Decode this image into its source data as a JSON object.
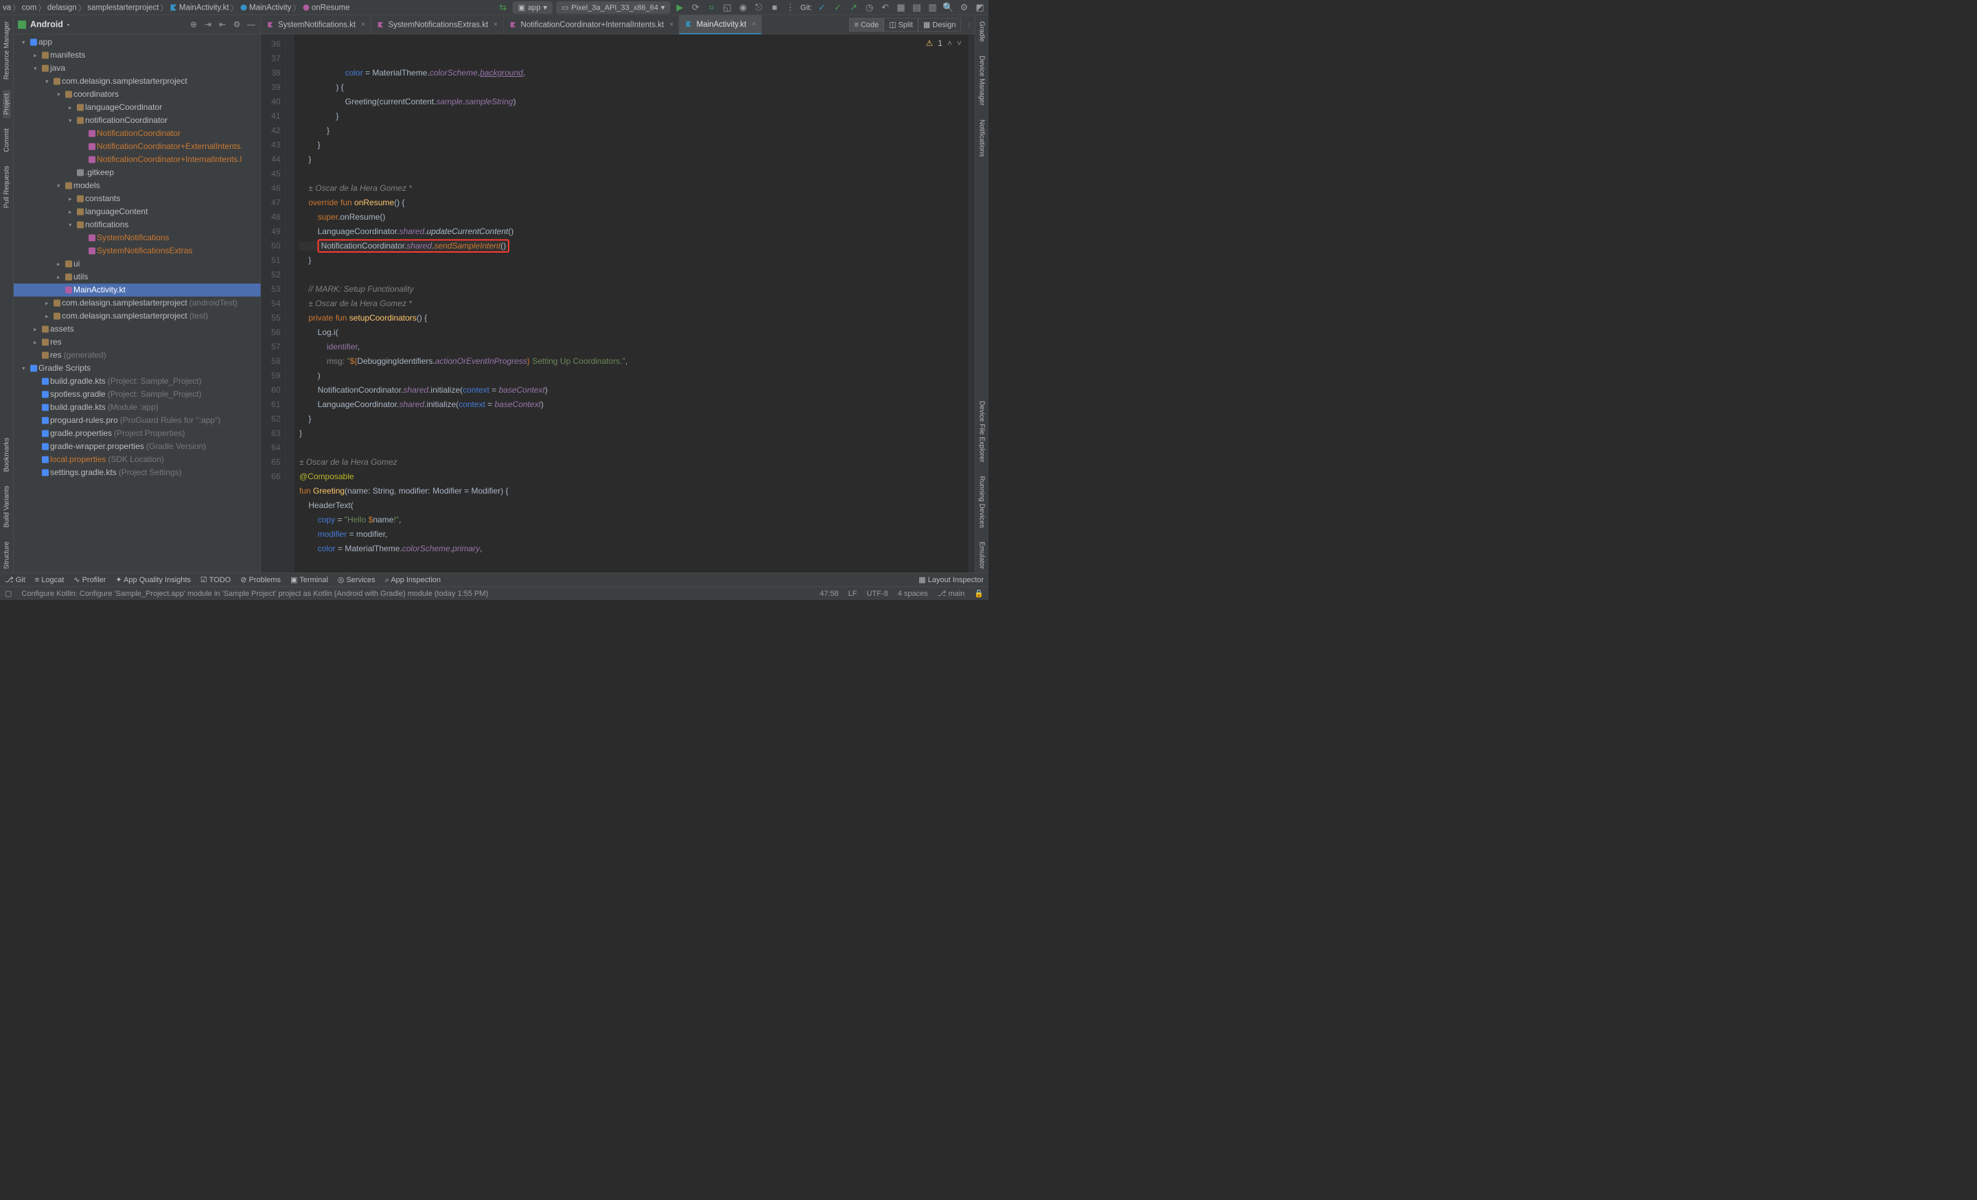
{
  "breadcrumbs": [
    "va",
    "com",
    "delasign",
    "samplestarterproject",
    "MainActivity.kt",
    "MainActivity",
    "onResume"
  ],
  "runConfig": {
    "app": "app",
    "device": "Pixel_3a_API_33_x86_64"
  },
  "gitLabel": "Git:",
  "sidebar": {
    "title": "Android",
    "tree": [
      {
        "d": 0,
        "arw": "▾",
        "ic": "mod",
        "txt": "app"
      },
      {
        "d": 1,
        "arw": "▸",
        "ic": "dir",
        "txt": "manifests"
      },
      {
        "d": 1,
        "arw": "▾",
        "ic": "dir",
        "txt": "java"
      },
      {
        "d": 2,
        "arw": "▾",
        "ic": "pkg",
        "txt": "com.delasign.samplestarterproject"
      },
      {
        "d": 3,
        "arw": "▾",
        "ic": "pkg",
        "txt": "coordinators"
      },
      {
        "d": 4,
        "arw": "▸",
        "ic": "pkg",
        "txt": "languageCoordinator"
      },
      {
        "d": 4,
        "arw": "▾",
        "ic": "pkg",
        "txt": "notificationCoordinator"
      },
      {
        "d": 5,
        "arw": "",
        "ic": "kt",
        "txt": "NotificationCoordinator",
        "orange": true
      },
      {
        "d": 5,
        "arw": "",
        "ic": "kt",
        "txt": "NotificationCoordinator+ExternalIntents.",
        "orange": true
      },
      {
        "d": 5,
        "arw": "",
        "ic": "kt",
        "txt": "NotificationCoordinator+InternalIntents.l",
        "orange": true
      },
      {
        "d": 4,
        "arw": "",
        "ic": "file",
        "txt": ".gitkeep"
      },
      {
        "d": 3,
        "arw": "▾",
        "ic": "pkg",
        "txt": "models"
      },
      {
        "d": 4,
        "arw": "▸",
        "ic": "pkg",
        "txt": "constants"
      },
      {
        "d": 4,
        "arw": "▸",
        "ic": "pkg",
        "txt": "languageContent"
      },
      {
        "d": 4,
        "arw": "▾",
        "ic": "pkg",
        "txt": "notifications"
      },
      {
        "d": 5,
        "arw": "",
        "ic": "kt",
        "txt": "SystemNotifications",
        "orange": true
      },
      {
        "d": 5,
        "arw": "",
        "ic": "kt",
        "txt": "SystemNotificationsExtras",
        "orange": true
      },
      {
        "d": 3,
        "arw": "▸",
        "ic": "pkg",
        "txt": "ui"
      },
      {
        "d": 3,
        "arw": "▸",
        "ic": "pkg",
        "txt": "utils"
      },
      {
        "d": 3,
        "arw": "",
        "ic": "kt",
        "txt": "MainActivity.kt",
        "sel": true
      },
      {
        "d": 2,
        "arw": "▸",
        "ic": "pkg",
        "txt": "com.delasign.samplestarterproject",
        "muted": "(androidTest)"
      },
      {
        "d": 2,
        "arw": "▸",
        "ic": "pkg",
        "txt": "com.delasign.samplestarterproject",
        "muted": "(test)"
      },
      {
        "d": 1,
        "arw": "▸",
        "ic": "dir",
        "txt": "assets"
      },
      {
        "d": 1,
        "arw": "▸",
        "ic": "dir",
        "txt": "res"
      },
      {
        "d": 1,
        "arw": "",
        "ic": "dir",
        "txt": "res",
        "muted": "(generated)"
      },
      {
        "d": 0,
        "arw": "▾",
        "ic": "grd",
        "txt": "Gradle Scripts"
      },
      {
        "d": 1,
        "arw": "",
        "ic": "grd",
        "txt": "build.gradle.kts",
        "muted": "(Project: Sample_Project)"
      },
      {
        "d": 1,
        "arw": "",
        "ic": "grd",
        "txt": "spotless.gradle",
        "muted": "(Project: Sample_Project)"
      },
      {
        "d": 1,
        "arw": "",
        "ic": "grd",
        "txt": "build.gradle.kts",
        "muted": "(Module :app)"
      },
      {
        "d": 1,
        "arw": "",
        "ic": "grd",
        "txt": "proguard-rules.pro",
        "muted": "(ProGuard Rules for \":app\")"
      },
      {
        "d": 1,
        "arw": "",
        "ic": "grd",
        "txt": "gradle.properties",
        "muted": "(Project Properties)"
      },
      {
        "d": 1,
        "arw": "",
        "ic": "grd",
        "txt": "gradle-wrapper.properties",
        "muted": "(Gradle Version)"
      },
      {
        "d": 1,
        "arw": "",
        "ic": "grd",
        "txt": "local.properties",
        "muted": "(SDK Location)",
        "orange": true
      },
      {
        "d": 1,
        "arw": "",
        "ic": "grd",
        "txt": "settings.gradle.kts",
        "muted": "(Project Settings)"
      }
    ]
  },
  "tabs": [
    {
      "label": "SystemNotifications.kt"
    },
    {
      "label": "SystemNotificationsExtras.kt"
    },
    {
      "label": "NotificationCoordinator+InternalIntents.kt"
    },
    {
      "label": "MainActivity.kt",
      "active": true
    }
  ],
  "modes": {
    "code": "Code",
    "split": "Split",
    "design": "Design"
  },
  "warnBadge": "1",
  "gutter": {
    "start": 36,
    "end": 66
  },
  "code": {
    "author1": "± Oscar de la Hera Gomez *",
    "author2": "± Oscar de la Hera Gomez *",
    "author3": "± Oscar de la Hera Gomez",
    "l36a": "color",
    "l36b": " = MaterialTheme.",
    "l36c": "colorScheme",
    "l36d": ".",
    "l36e": "background",
    "l36f": ",",
    "l37": ") {",
    "l38a": "Greeting(currentContent.",
    "l38b": "sample",
    "l38c": ".",
    "l38d": "sampleString",
    "l38e": ")",
    "l39": "}",
    "l40": "}",
    "l41": "}",
    "l42": "}",
    "l44a": "override",
    "l44b": " fun ",
    "l44c": "onResume",
    "l44d": "() {",
    "l45a": "super",
    "l45b": ".onResume()",
    "l46a": "LanguageCoordinator.",
    "l46b": "shared",
    "l46c": ".",
    "l46d": "updateCurrentContent",
    "l46e": "()",
    "l47a": "NotificationCoordinator.",
    "l47b": "shared",
    "l47c": ".",
    "l47d": "sendSampleIntent",
    "l47e": "()",
    "l48": "}",
    "l50": "// MARK: Setup Functionality",
    "l51a": "private",
    "l51b": " fun ",
    "l51c": "setupCoordinators",
    "l51d": "() {",
    "l52": "Log.i(",
    "l53a": "identifier",
    "l53b": ",",
    "l54a": "msg:",
    "l54b": " \"",
    "l54c": "${",
    "l54d": "DebuggingIdentifiers.",
    "l54e": "actionOrEventInProgress",
    "l54f": "}",
    "l54g": " Setting Up Coordinators.\"",
    "l54h": ",",
    "l55": ")",
    "l56a": "NotificationCoordinator.",
    "l56b": "shared",
    "l56c": ".initialize(",
    "l56d": "context",
    "l56e": " = ",
    "l56f": "baseContext",
    "l56g": ")",
    "l57a": "LanguageCoordinator.",
    "l57b": "shared",
    "l57c": ".initialize(",
    "l57d": "context",
    "l57e": " = ",
    "l57f": "baseContext",
    "l57g": ")",
    "l58": "}",
    "l59": "}",
    "l61": "@Composable",
    "l62a": "fun ",
    "l62b": "Greeting",
    "l62c": "(name: String, modifier: Modifier = Modifier) {",
    "l63": "HeaderText(",
    "l64a": "copy",
    "l64b": " = ",
    "l64c": "\"Hello ",
    "l64d": "$",
    "l64e": "name",
    "l64f": "!\"",
    "l64g": ",",
    "l65a": "modifier",
    "l65b": " = modifier,",
    "l66a": "color",
    "l66b": " = MaterialTheme.",
    "l66c": "colorScheme",
    "l66d": ".",
    "l66e": "primary",
    "l66f": ","
  },
  "leftTools": [
    "Resource Manager",
    "Project",
    "Commit",
    "Pull Requests",
    "Bookmarks",
    "Build Variants",
    "Structure"
  ],
  "rightTools": [
    "Gradle",
    "Device Manager",
    "Notifications",
    "Device File Explorer",
    "Running Devices",
    "Emulator"
  ],
  "bottomTools": {
    "git": "Git",
    "logcat": "Logcat",
    "profiler": "Profiler",
    "quality": "App Quality Insights",
    "todo": "TODO",
    "problems": "Problems",
    "terminal": "Terminal",
    "services": "Services",
    "inspection": "App Inspection",
    "layoutInsp": "Layout Inspector"
  },
  "status": {
    "msg": "Configure Kotlin: Configure 'Sample_Project.app' module in 'Sample Project' project as Kotlin (Android with Gradle) module (today 1:55 PM)",
    "pos": "47:58",
    "lf": "LF",
    "enc": "UTF-8",
    "indent": "4 spaces",
    "branch": "main"
  }
}
